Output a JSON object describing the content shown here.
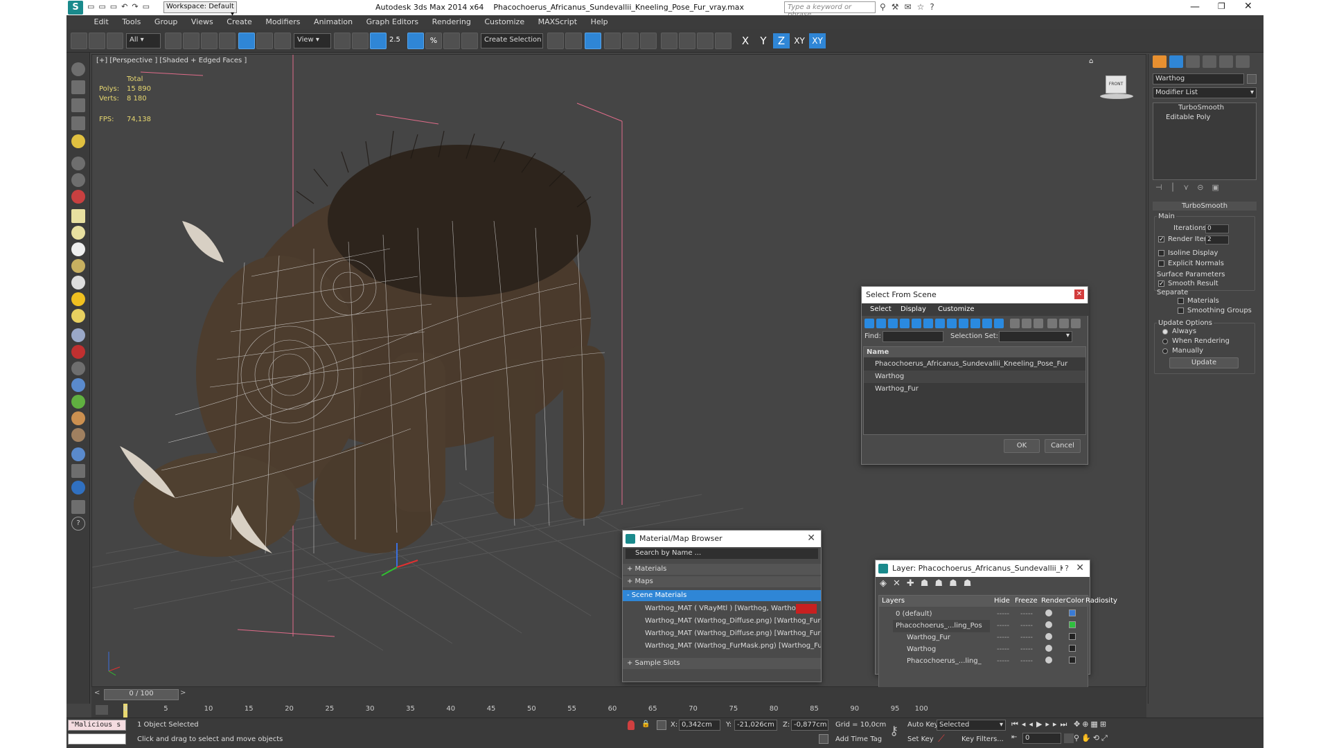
{
  "titlebar": {
    "app": "Autodesk 3ds Max  2014 x64",
    "file": "Phacochoerus_Africanus_Sundevallii_Kneeling_Pose_Fur_vray.max",
    "workspace": "Workspace: Default",
    "search_placeholder": "Type a keyword or phrase"
  },
  "menu": [
    "Edit",
    "Tools",
    "Group",
    "Views",
    "Create",
    "Modifiers",
    "Animation",
    "Graph Editors",
    "Rendering",
    "Customize",
    "MAXScript",
    "Help"
  ],
  "toolbar": {
    "filter": "All",
    "refcoord": "View",
    "selset": "Create Selection Se",
    "angle_snap": "2.5",
    "axes": [
      "X",
      "Y",
      "Z",
      "XY",
      "XY"
    ]
  },
  "viewport": {
    "label": "[+] [Perspective ] [Shaded + Edged Faces ]",
    "stats": {
      "header": "Total",
      "polys_label": "Polys:",
      "polys": "15 890",
      "verts_label": "Verts:",
      "verts": "8 180",
      "fps_label": "FPS:",
      "fps": "74,138"
    },
    "viewcube": "FRONT"
  },
  "command_panel": {
    "object_name": "Warthog",
    "modifier_list": "Modifier List",
    "stack": [
      "TurboSmooth",
      "Editable Poly"
    ],
    "rollout": "TurboSmooth",
    "main": "Main",
    "iterations_label": "Iterations:",
    "iterations": "0",
    "render_iters_label": "Render Iters:",
    "render_iters": "2",
    "isoline": "Isoline Display",
    "explicit": "Explicit Normals",
    "surface": "Surface Parameters",
    "smooth": "Smooth Result",
    "separate": "Separate",
    "materials": "Materials",
    "smoothing": "Smoothing Groups",
    "update_options": "Update Options",
    "always": "Always",
    "when_rendering": "When Rendering",
    "manually": "Manually",
    "update": "Update"
  },
  "select_from_scene": {
    "title": "Select From Scene",
    "tabs": [
      "Select",
      "Display",
      "Customize"
    ],
    "find_label": "Find:",
    "selset_label": "Selection Set:",
    "col_name": "Name",
    "items": [
      "Phacochoerus_Africanus_Sundevallii_Kneeling_Pose_Fur",
      "Warthog",
      "Warthog_Fur"
    ],
    "ok": "OK",
    "cancel": "Cancel"
  },
  "material_browser": {
    "title": "Material/Map Browser",
    "search": "Search by Name ...",
    "sections": [
      "+ Materials",
      "+ Maps",
      "- Scene Materials"
    ],
    "items": [
      "Warthog_MAT  ( VRayMtl )  [Warthog, Warthog_Fur]",
      "Warthog_MAT (Warthog_Diffuse.png) [Warthog_Fur]",
      "Warthog_MAT (Warthog_Diffuse.png) [Warthog_Fur]",
      "Warthog_MAT (Warthog_FurMask.png) [Warthog_Fur]"
    ],
    "sample_slots": "+ Sample Slots"
  },
  "layer_manager": {
    "title": "Layer: Phacochoerus_Africanus_Sundevallii_Kneeling_P...",
    "question": "?",
    "cols": [
      "Layers",
      "Hide",
      "Freeze",
      "Render",
      "Color",
      "Radiosity"
    ],
    "rows": [
      {
        "name": "0 (default)",
        "color": "#3a7bd5"
      },
      {
        "name": "Phacochoerus_...ling_Pos",
        "color": "#2fbf3f"
      },
      {
        "name": "Warthog_Fur",
        "color": "#222222"
      },
      {
        "name": "Warthog",
        "color": "#222222"
      },
      {
        "name": "Phacochoerus_...ling_",
        "color": "#222222"
      }
    ],
    "dots": "-----"
  },
  "timeline": {
    "frame": "0 / 100",
    "ticks": [
      "0",
      "5",
      "10",
      "15",
      "20",
      "25",
      "30",
      "35",
      "40",
      "45",
      "50",
      "55",
      "60",
      "65",
      "70",
      "75",
      "80",
      "85",
      "90",
      "95",
      "100"
    ]
  },
  "status": {
    "maxscript": "\"Malicious s",
    "selected": "1 Object Selected",
    "prompt": "Click and drag to select and move objects",
    "x_label": "X:",
    "x": "0,342cm",
    "y_label": "Y:",
    "y": "-21,026cm",
    "z_label": "Z:",
    "z": "-0,877cm",
    "grid": "Grid = 10,0cm",
    "add_time_tag": "Add Time Tag",
    "auto_key": "Auto Key",
    "set_key": "Set Key",
    "key_mode": "Selected",
    "key_filters": "Key Filters...",
    "frame_field": "0"
  }
}
